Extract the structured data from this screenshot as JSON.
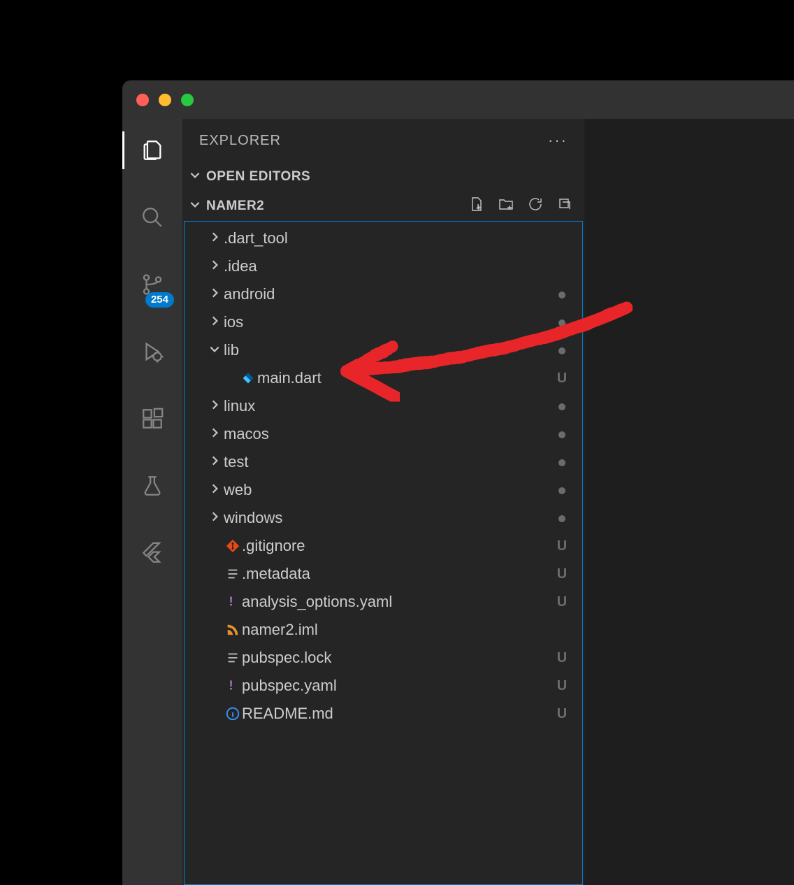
{
  "sidebar": {
    "title": "EXPLORER",
    "openEditorsLabel": "OPEN EDITORS",
    "projectName": "NAMER2"
  },
  "scmBadge": "254",
  "tree": [
    {
      "type": "folder",
      "name": ".dart_tool",
      "depth": 1,
      "expanded": false,
      "deco": ""
    },
    {
      "type": "folder",
      "name": ".idea",
      "depth": 1,
      "expanded": false,
      "deco": ""
    },
    {
      "type": "folder",
      "name": "android",
      "depth": 1,
      "expanded": false,
      "deco": "dot"
    },
    {
      "type": "folder",
      "name": "ios",
      "depth": 1,
      "expanded": false,
      "deco": "dot"
    },
    {
      "type": "folder",
      "name": "lib",
      "depth": 1,
      "expanded": true,
      "deco": "dot"
    },
    {
      "type": "file",
      "name": "main.dart",
      "depth": 2,
      "icon": "dart",
      "deco": "U"
    },
    {
      "type": "folder",
      "name": "linux",
      "depth": 1,
      "expanded": false,
      "deco": "dot"
    },
    {
      "type": "folder",
      "name": "macos",
      "depth": 1,
      "expanded": false,
      "deco": "dot"
    },
    {
      "type": "folder",
      "name": "test",
      "depth": 1,
      "expanded": false,
      "deco": "dot"
    },
    {
      "type": "folder",
      "name": "web",
      "depth": 1,
      "expanded": false,
      "deco": "dot"
    },
    {
      "type": "folder",
      "name": "windows",
      "depth": 1,
      "expanded": false,
      "deco": "dot"
    },
    {
      "type": "file",
      "name": ".gitignore",
      "depth": 1,
      "icon": "git",
      "deco": "U"
    },
    {
      "type": "file",
      "name": ".metadata",
      "depth": 1,
      "icon": "lines",
      "deco": "U"
    },
    {
      "type": "file",
      "name": "analysis_options.yaml",
      "depth": 1,
      "icon": "yaml",
      "deco": "U"
    },
    {
      "type": "file",
      "name": "namer2.iml",
      "depth": 1,
      "icon": "feed",
      "deco": ""
    },
    {
      "type": "file",
      "name": "pubspec.lock",
      "depth": 1,
      "icon": "lines",
      "deco": "U"
    },
    {
      "type": "file",
      "name": "pubspec.yaml",
      "depth": 1,
      "icon": "yaml",
      "deco": "U"
    },
    {
      "type": "file",
      "name": "README.md",
      "depth": 1,
      "icon": "info",
      "deco": "U"
    }
  ]
}
